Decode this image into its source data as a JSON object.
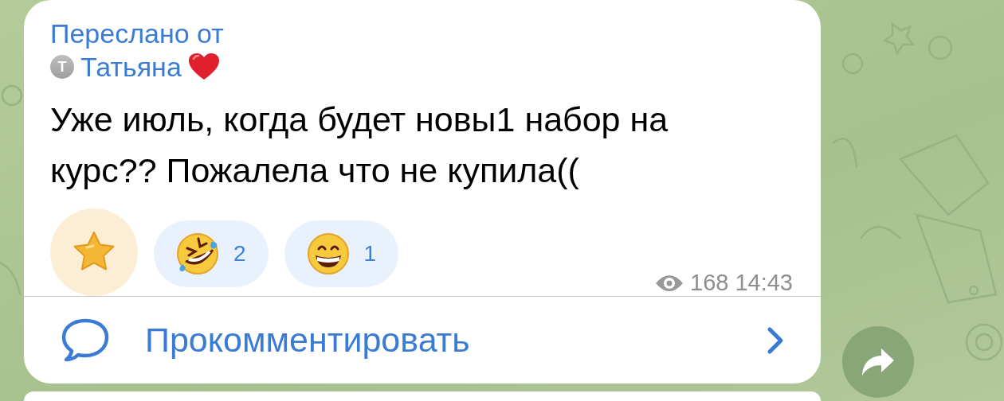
{
  "post": {
    "forwarded_label": "Переслано от",
    "author": {
      "initial": "Т",
      "name": "Татьяна"
    },
    "text": "Уже июль, когда будет новы1 набор на курс?? Пожалела что не купила((",
    "reactions": [
      {
        "kind": "star"
      },
      {
        "kind": "rolling-laugh",
        "count": "2"
      },
      {
        "kind": "grin",
        "count": "1"
      }
    ],
    "views": "168",
    "time": "14:43",
    "comment_label": "Прокомментировать"
  }
}
